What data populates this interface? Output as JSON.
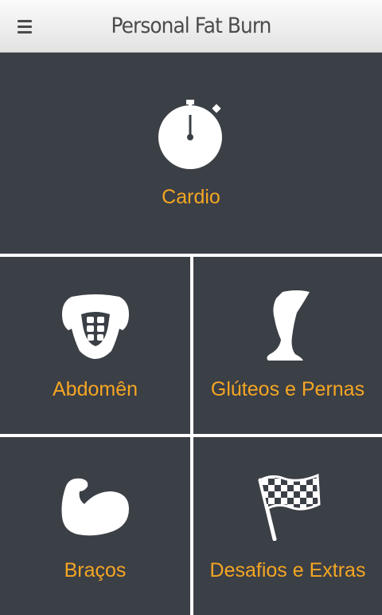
{
  "header": {
    "title": "Personal Fat Burn",
    "menu_icon": "hamburger-menu-icon"
  },
  "tiles": [
    {
      "label": "Cardio",
      "icon": "stopwatch-icon"
    },
    {
      "label": "Abdomên",
      "icon": "torso-abs-icon"
    },
    {
      "label": "Glúteos e Pernas",
      "icon": "leg-icon"
    },
    {
      "label": "Braços",
      "icon": "flexed-arm-icon"
    },
    {
      "label": "Desafios e Extras",
      "icon": "checkered-flag-icon"
    }
  ],
  "colors": {
    "tile_background": "#3b3f46",
    "label_accent": "#f5a623",
    "icon": "#ffffff",
    "divider": "#ffffff"
  }
}
